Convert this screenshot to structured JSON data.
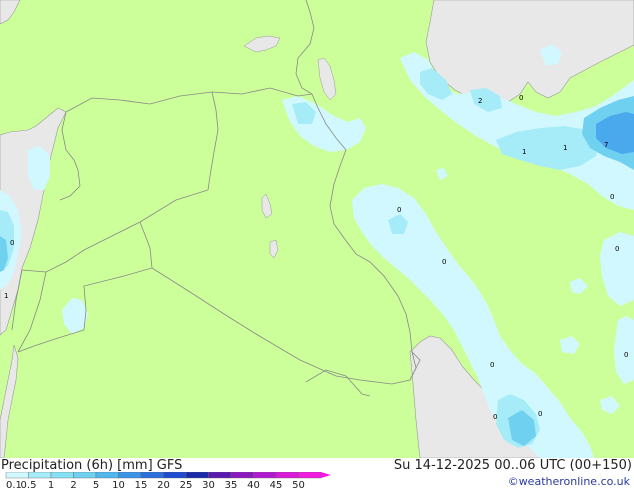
{
  "title": "Precipitation (6h) [mm] GFS",
  "datetime": "Su 14-12-2025 00..06 UTC (00+150)",
  "credit": "©weatheronline.co.uk",
  "colors": {
    "land": "#ccff99",
    "sea": "#e8e8e8",
    "border": "#888888",
    "coast": "#999999",
    "precip_0_1": "#d2f8ff",
    "precip_0_5": "#a6ecf8",
    "precip_1": "#6fd0f0",
    "precip_2": "#4aa8ec"
  },
  "legend": {
    "ticks": [
      "0.1",
      "0.5",
      "1",
      "2",
      "5",
      "10",
      "15",
      "20",
      "25",
      "30",
      "35",
      "40",
      "45",
      "50"
    ],
    "swatches": [
      "#d2f8ff",
      "#a6ecf8",
      "#86dff4",
      "#6fd0f0",
      "#4fb8ee",
      "#3a93e6",
      "#2a6fdc",
      "#1e4bd0",
      "#1a2aa8",
      "#5a1ab0",
      "#8a1ac0",
      "#b21ad0",
      "#d81ad8",
      "#f01ae0"
    ]
  },
  "map_labels": [
    {
      "text": "2"
    },
    {
      "text": "0"
    },
    {
      "text": "1"
    },
    {
      "text": "1"
    },
    {
      "text": "7"
    },
    {
      "text": "0"
    },
    {
      "text": "0"
    },
    {
      "text": "0"
    },
    {
      "text": "0"
    },
    {
      "text": "1"
    },
    {
      "text": "0"
    },
    {
      "text": "0"
    },
    {
      "text": "0"
    },
    {
      "text": "0"
    },
    {
      "text": "0"
    },
    {
      "text": "0"
    }
  ]
}
